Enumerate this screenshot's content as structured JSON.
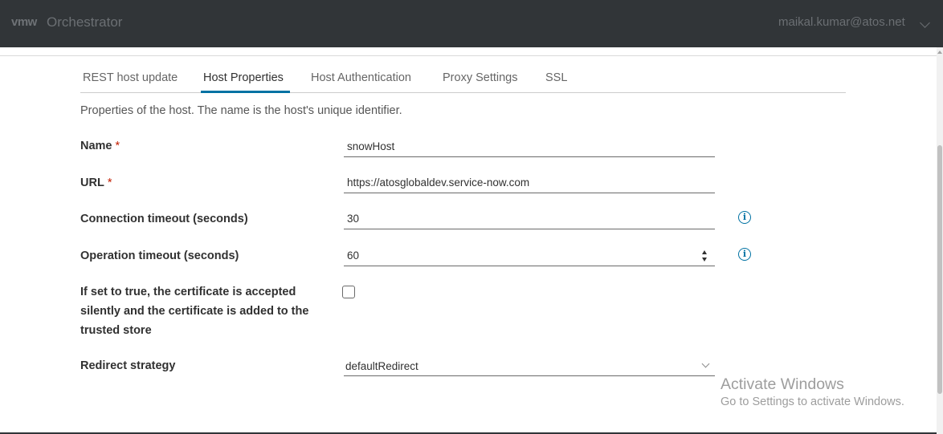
{
  "header": {
    "logo": "vmw",
    "app_name": "Orchestrator",
    "user": "maikal.kumar@atos.net"
  },
  "tabs": [
    {
      "label": "REST host update",
      "active": false
    },
    {
      "label": "Host Properties",
      "active": true
    },
    {
      "label": "Host Authentication",
      "active": false
    },
    {
      "label": "Proxy Settings",
      "active": false
    },
    {
      "label": "SSL",
      "active": false
    }
  ],
  "description": "Properties of the host. The name is the host's unique identifier.",
  "form": {
    "required_marker": "*",
    "name": {
      "label": "Name",
      "value": "snowHost"
    },
    "url": {
      "label": "URL",
      "value": "https://atosglobaldev.service-now.com"
    },
    "connection_timeout": {
      "label": "Connection timeout (seconds)",
      "value": "30",
      "info_icon": "i"
    },
    "operation_timeout": {
      "label": "Operation timeout (seconds)",
      "value": "60",
      "info_icon": "i"
    },
    "accept_certificate": {
      "label": "If set to true, the certificate is accepted silently and the certificate is added to the trusted store",
      "checked": false
    },
    "redirect_strategy": {
      "label": "Redirect strategy",
      "value": "defaultRedirect"
    }
  },
  "watermark": {
    "title": "Activate Windows",
    "subtitle": "Go to Settings to activate Windows."
  },
  "colors": {
    "header_bg": "#313538",
    "accent": "#0072a3",
    "required": "#c21d00"
  }
}
